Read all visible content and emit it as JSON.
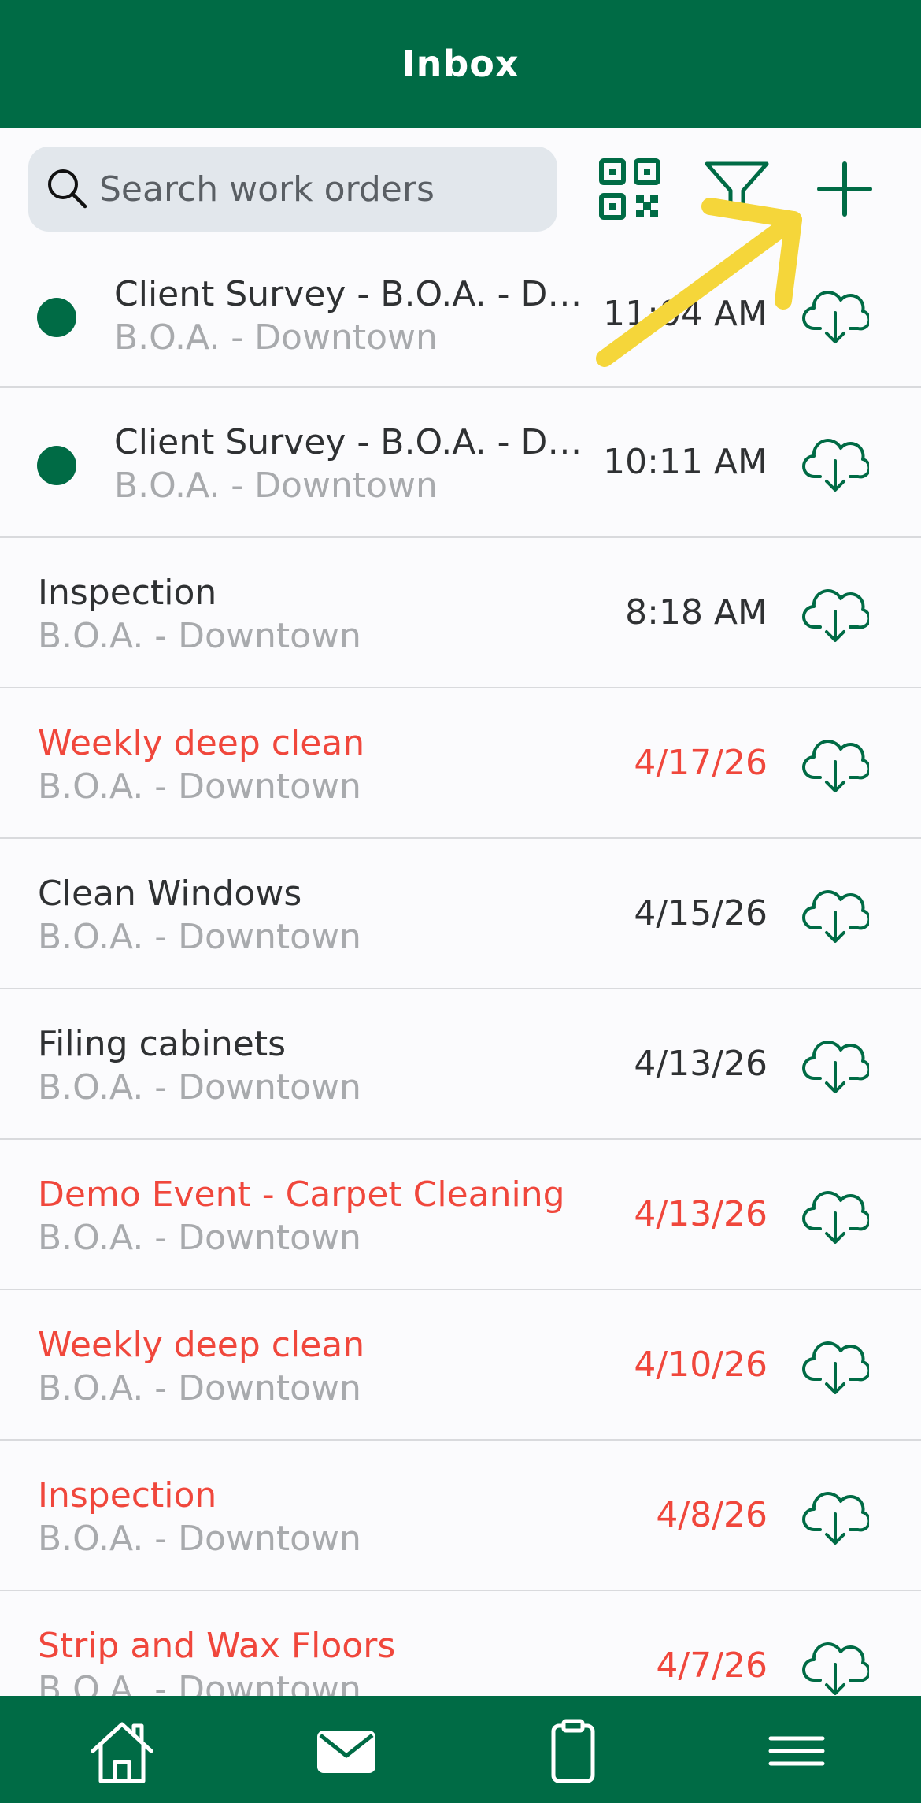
{
  "header": {
    "title": "Inbox"
  },
  "search": {
    "placeholder": "Search work orders"
  },
  "toolbar": {
    "icons": [
      "qr-code-icon",
      "filter-icon",
      "plus-icon"
    ]
  },
  "colors": {
    "brand": "#006b45",
    "overdue": "#f0473c",
    "text": "#2f3133",
    "subtext": "#a8aaad",
    "annotation_arrow": "#f5d63a"
  },
  "work_orders": [
    {
      "title": "Client Survey - B.O.A. - Do…",
      "location": "B.O.A. - Downtown",
      "date": "11:04 AM",
      "unread": true,
      "overdue": false
    },
    {
      "title": "Client Survey - B.O.A. - Do…",
      "location": "B.O.A. - Downtown",
      "date": "10:11 AM",
      "unread": true,
      "overdue": false
    },
    {
      "title": "Inspection",
      "location": "B.O.A. - Downtown",
      "date": "8:18 AM",
      "unread": false,
      "overdue": false
    },
    {
      "title": "Weekly deep clean",
      "location": "B.O.A. - Downtown",
      "date": "4/17/26",
      "unread": false,
      "overdue": true
    },
    {
      "title": "Clean Windows",
      "location": "B.O.A. - Downtown",
      "date": "4/15/26",
      "unread": false,
      "overdue": false
    },
    {
      "title": "Filing cabinets",
      "location": "B.O.A. - Downtown",
      "date": "4/13/26",
      "unread": false,
      "overdue": false
    },
    {
      "title": "Demo Event - Carpet Cleaning",
      "location": "B.O.A. - Downtown",
      "date": "4/13/26",
      "unread": false,
      "overdue": true
    },
    {
      "title": "Weekly deep clean",
      "location": "B.O.A. - Downtown",
      "date": "4/10/26",
      "unread": false,
      "overdue": true
    },
    {
      "title": "Inspection",
      "location": "B.O.A. - Downtown",
      "date": "4/8/26",
      "unread": false,
      "overdue": true
    },
    {
      "title": "Strip and Wax Floors",
      "location": "B.O.A. - Downtown",
      "date": "4/7/26",
      "unread": false,
      "overdue": true
    }
  ],
  "tabbar": {
    "tabs": [
      "home-icon",
      "mail-icon",
      "clipboard-icon",
      "menu-icon"
    ],
    "active": "mail-icon"
  }
}
